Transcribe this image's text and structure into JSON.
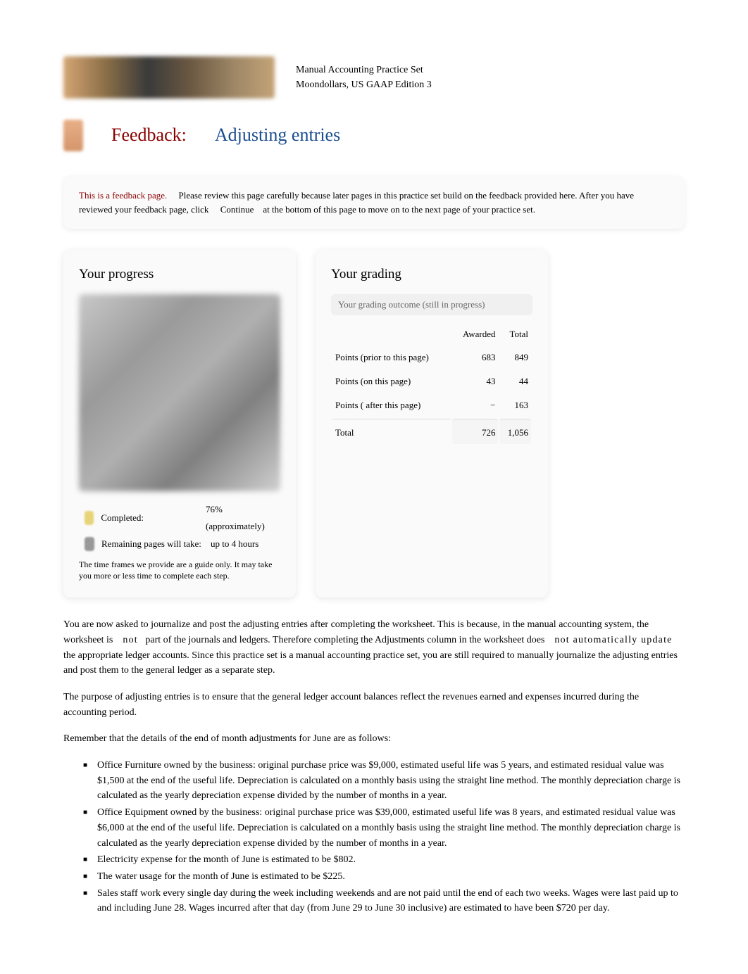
{
  "header": {
    "line1": "Manual Accounting Practice Set",
    "line2": "Moondollars, US GAAP Edition 3"
  },
  "title": {
    "feedback": "Feedback:",
    "sub": "Adjusting entries"
  },
  "notice": {
    "intro": "This is a feedback page.",
    "part1": "Please review this page carefully because later pages in this practice set build on the feedback provided here. After you have reviewed your feedback page, click",
    "button": "Continue",
    "part2": "at the bottom of this page to move on to the next page of your practice set."
  },
  "progress": {
    "heading": "Your progress",
    "completed_label": "Completed:",
    "completed_value": "76% (approximately)",
    "remaining_label": "Remaining pages will take:",
    "remaining_value": "up to 4 hours",
    "note": "The time frames we provide are a guide only. It may take you more or less time to complete each step."
  },
  "grading": {
    "heading": "Your grading",
    "subtitle": "Your grading outcome (still in progress)",
    "col_awarded": "Awarded",
    "col_total": "Total",
    "rows": [
      {
        "label": "Points (prior to this page)",
        "awarded": "683",
        "total": "849"
      },
      {
        "label": "Points (on this page)",
        "awarded": "43",
        "total": "44"
      },
      {
        "label": "Points ( after  this page)",
        "awarded": "−",
        "total": "163"
      }
    ],
    "total_label": "Total",
    "total_awarded": "726",
    "total_total": "1,056"
  },
  "body": {
    "para1_a": "You are now asked to journalize and post the adjusting entries after completing the worksheet. This is because, in the manual accounting system, the worksheet is",
    "para1_not": "not",
    "para1_b": "part of the journals and ledgers. Therefore completing the Adjustments column in the worksheet does",
    "para1_nau": "not automatically update",
    "para1_c": "the appropriate ledger accounts. Since this practice set is a manual accounting practice set, you are still required to manually journalize the adjusting entries and post them to the general ledger as a separate step.",
    "para2": "The purpose of adjusting entries is to ensure that the general ledger account balances reflect the revenues earned and expenses incurred during the accounting period.",
    "para3": "Remember that the details of the end of month adjustments for June are as follows:",
    "items": [
      "Office Furniture owned by the business: original purchase price was $9,000, estimated useful life was 5 years, and estimated residual value was $1,500 at the end of the useful life. Depreciation is calculated on a monthly basis using the straight line method. The monthly depreciation charge is calculated as the yearly depreciation expense divided by the number of months in a year.",
      "Office Equipment owned by the business: original purchase price was $39,000, estimated useful life was 8 years, and estimated residual value was $6,000 at the end of the useful life. Depreciation is calculated on a monthly basis using the straight line method. The monthly depreciation charge is calculated as the yearly depreciation expense divided by the number of months in a year.",
      "Electricity expense for the month of June is estimated to be $802.",
      "The water usage for the month of June is estimated to be $225.",
      "Sales staff work every single day during the week including weekends and are not paid until the end of each two weeks. Wages were last paid up to and including June 28. Wages incurred after that day (from June 29 to June 30 inclusive) are estimated to have been $720 per day."
    ]
  }
}
